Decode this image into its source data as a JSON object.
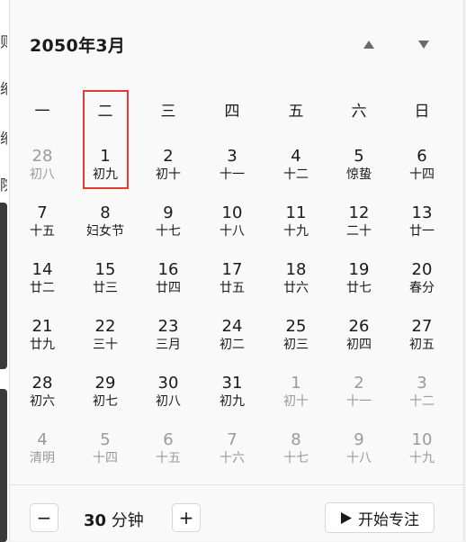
{
  "calendar": {
    "title": "2050年3月",
    "weekdays": [
      "一",
      "二",
      "三",
      "四",
      "五",
      "六",
      "日"
    ],
    "selected_column": "二",
    "weeks": [
      [
        {
          "solar": "28",
          "lunar": "初八",
          "dim": true
        },
        {
          "solar": "1",
          "lunar": "初九",
          "dim": false
        },
        {
          "solar": "2",
          "lunar": "初十",
          "dim": false
        },
        {
          "solar": "3",
          "lunar": "十一",
          "dim": false
        },
        {
          "solar": "4",
          "lunar": "十二",
          "dim": false
        },
        {
          "solar": "5",
          "lunar": "惊蛰",
          "dim": false
        },
        {
          "solar": "6",
          "lunar": "十四",
          "dim": false
        }
      ],
      [
        {
          "solar": "7",
          "lunar": "十五",
          "dim": false
        },
        {
          "solar": "8",
          "lunar": "妇女节",
          "dim": false
        },
        {
          "solar": "9",
          "lunar": "十七",
          "dim": false
        },
        {
          "solar": "10",
          "lunar": "十八",
          "dim": false
        },
        {
          "solar": "11",
          "lunar": "十九",
          "dim": false
        },
        {
          "solar": "12",
          "lunar": "二十",
          "dim": false
        },
        {
          "solar": "13",
          "lunar": "廿一",
          "dim": false
        }
      ],
      [
        {
          "solar": "14",
          "lunar": "廿二",
          "dim": false
        },
        {
          "solar": "15",
          "lunar": "廿三",
          "dim": false
        },
        {
          "solar": "16",
          "lunar": "廿四",
          "dim": false
        },
        {
          "solar": "17",
          "lunar": "廿五",
          "dim": false
        },
        {
          "solar": "18",
          "lunar": "廿六",
          "dim": false
        },
        {
          "solar": "19",
          "lunar": "廿七",
          "dim": false
        },
        {
          "solar": "20",
          "lunar": "春分",
          "dim": false
        }
      ],
      [
        {
          "solar": "21",
          "lunar": "廿九",
          "dim": false
        },
        {
          "solar": "22",
          "lunar": "三十",
          "dim": false
        },
        {
          "solar": "23",
          "lunar": "三月",
          "dim": false
        },
        {
          "solar": "24",
          "lunar": "初二",
          "dim": false
        },
        {
          "solar": "25",
          "lunar": "初三",
          "dim": false
        },
        {
          "solar": "26",
          "lunar": "初四",
          "dim": false
        },
        {
          "solar": "27",
          "lunar": "初五",
          "dim": false
        }
      ],
      [
        {
          "solar": "28",
          "lunar": "初六",
          "dim": false
        },
        {
          "solar": "29",
          "lunar": "初七",
          "dim": false
        },
        {
          "solar": "30",
          "lunar": "初八",
          "dim": false
        },
        {
          "solar": "31",
          "lunar": "初九",
          "dim": false
        },
        {
          "solar": "1",
          "lunar": "初十",
          "dim": true
        },
        {
          "solar": "2",
          "lunar": "十一",
          "dim": true
        },
        {
          "solar": "3",
          "lunar": "十二",
          "dim": true
        }
      ],
      [
        {
          "solar": "4",
          "lunar": "清明",
          "dim": true
        },
        {
          "solar": "5",
          "lunar": "十四",
          "dim": true
        },
        {
          "solar": "6",
          "lunar": "十五",
          "dim": true
        },
        {
          "solar": "7",
          "lunar": "十六",
          "dim": true
        },
        {
          "solar": "8",
          "lunar": "十七",
          "dim": true
        },
        {
          "solar": "9",
          "lunar": "十八",
          "dim": true
        },
        {
          "solar": "10",
          "lunar": "十九",
          "dim": true
        }
      ]
    ]
  },
  "background_peek": {
    "chars": [
      "则",
      "缩",
      "缩",
      "院"
    ]
  },
  "focus": {
    "minus_label": "−",
    "plus_label": "+",
    "duration_value": "30",
    "duration_unit": "分钟",
    "start_label": "开始专注"
  },
  "icons": {
    "nav_up": "triangle-up-icon",
    "nav_down": "triangle-down-icon",
    "play": "play-icon"
  },
  "colors": {
    "highlight": "#e53935",
    "dim_text": "#9a9a9a",
    "panel_bg": "#f9f9f9"
  }
}
